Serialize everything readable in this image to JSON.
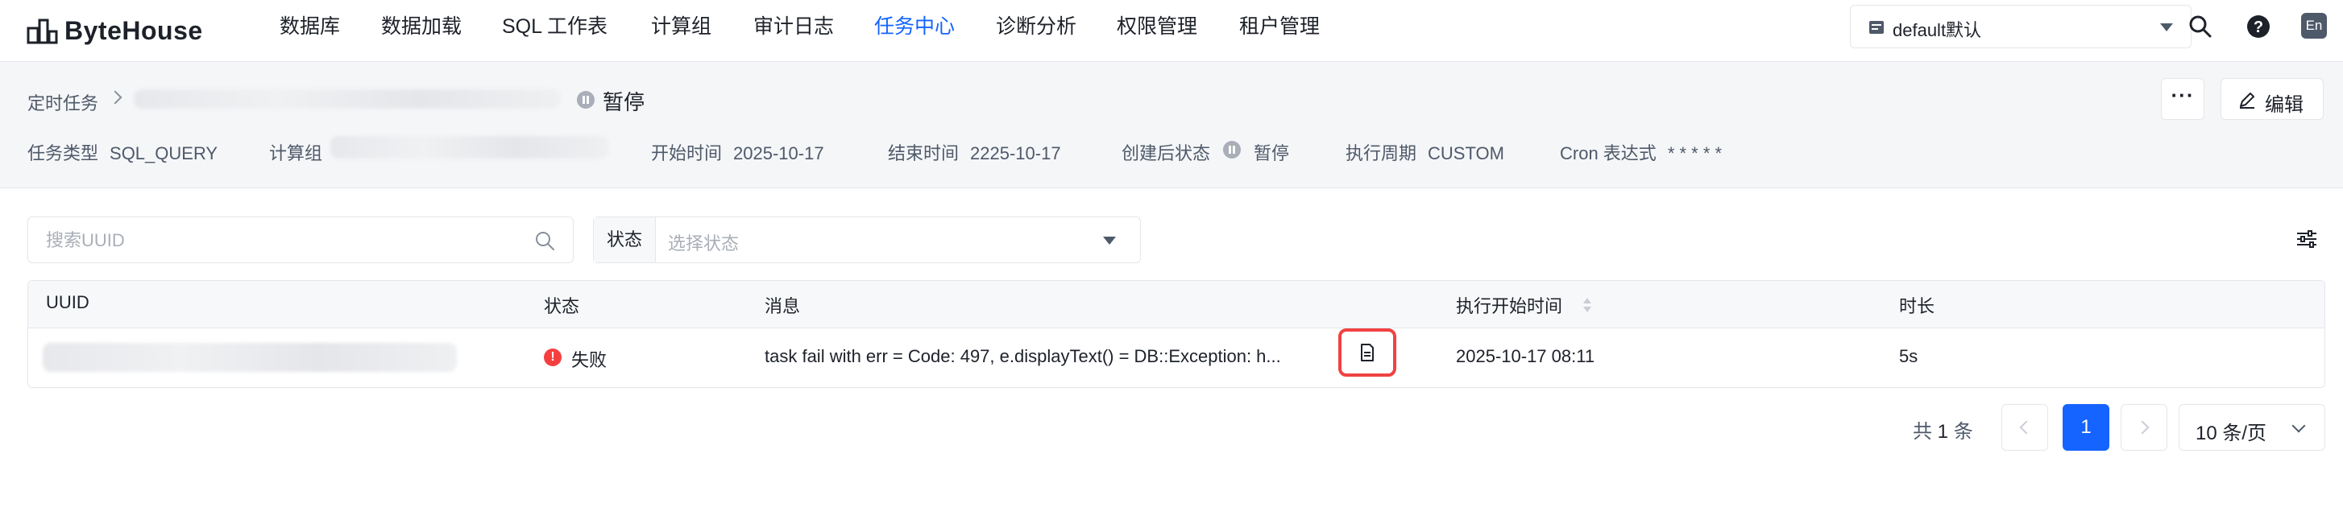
{
  "app": {
    "name": "ByteHouse"
  },
  "nav": {
    "items": [
      "数据库",
      "数据加载",
      "SQL 工作表",
      "计算组",
      "审计日志",
      "任务中心",
      "诊断分析",
      "权限管理",
      "租户管理"
    ],
    "active": "任务中心"
  },
  "workspace": {
    "selected": "default默认"
  },
  "lang": "En",
  "breadcrumb": {
    "parent": "定时任务"
  },
  "task": {
    "status": "暂停",
    "more_label": "···",
    "edit_label": "编辑",
    "meta": {
      "type_label": "任务类型",
      "type_value": "SQL_QUERY",
      "group_label": "计算组",
      "start_label": "开始时间",
      "start_value": "2025-10-17",
      "end_label": "结束时间",
      "end_value": "2225-10-17",
      "created_status_label": "创建后状态",
      "created_status_value": "暂停",
      "period_label": "执行周期",
      "period_value": "CUSTOM",
      "cron_label": "Cron 表达式",
      "cron_value": "* * * * *"
    }
  },
  "filters": {
    "search_placeholder": "搜索UUID",
    "status_label": "状态",
    "status_placeholder": "选择状态"
  },
  "table": {
    "columns": [
      "UUID",
      "状态",
      "消息",
      "执行开始时间",
      "时长"
    ],
    "rows": [
      {
        "status": "失败",
        "status_color": "#f53f3f",
        "message": "task fail with err = Code: 497, e.displayText() = DB::Exception: h...",
        "start_time": "2025-10-17 08:11",
        "duration": "5s"
      }
    ]
  },
  "pagination": {
    "total_prefix": "共",
    "total": "1",
    "total_suffix": "条",
    "current_page": "1",
    "page_size": "10 条/页"
  },
  "colors": {
    "accent": "#1664ff",
    "error": "#f53f3f",
    "highlight_border": "#f04242"
  }
}
